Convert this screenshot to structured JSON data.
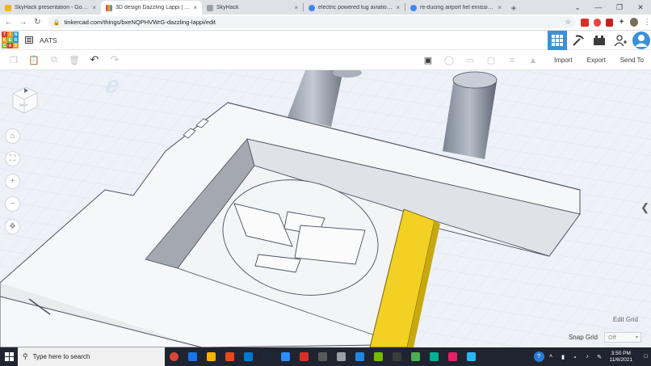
{
  "browser": {
    "tabs": [
      {
        "label": "SkyHack presentation - Google Sl",
        "favicon_color": "#f4b400",
        "active": false
      },
      {
        "label": "3D design Dazzling Lappi | Tinke",
        "favicon_color": "#e64b3c",
        "active": true
      },
      {
        "label": "SkyHack",
        "favicon_color": "#9aa0a6",
        "active": false
      },
      {
        "label": "electric powered tug aviation - G",
        "favicon_color": "#4285f4",
        "active": false
      },
      {
        "label": "re-ducing airport fiel emissions -",
        "favicon_color": "#4285f4",
        "active": false
      }
    ],
    "tab_close_glyph": "×",
    "new_tab_glyph": "+",
    "window_controls": {
      "dropdown": "⌄",
      "minimize": "—",
      "maximize": "❐",
      "close": "✕"
    },
    "url": "tinkercad.com/things/bxeNQPHVWrG-dazzling-lappi/edit"
  },
  "app": {
    "logo_letters": [
      "TIN",
      "KER",
      "CAD"
    ],
    "logo_colors": [
      "#e2372f",
      "#f29a1d",
      "#2b9fd9",
      "#f29a1d",
      "#7bbf44",
      "#2b9fd9",
      "#7bbf44",
      "#e2372f",
      "#f29a1d"
    ],
    "design_name": "AATS",
    "accent": "#3d8fd9"
  },
  "toolbar": {
    "import_label": "Import",
    "export_label": "Export",
    "send_to_label": "Send To"
  },
  "canvas": {
    "viewcube_label": "BACK",
    "edit_grid_label": "Edit Grid",
    "snap_grid_label": "Snap Grid",
    "snap_grid_value": "Off",
    "highlight_color": "#f2d024"
  },
  "taskbar": {
    "search_placeholder": "Type here to search",
    "time": "3:50 PM",
    "date": "11/6/2021",
    "app_colors": [
      "#db4437",
      "#1a73e8",
      "#f4b400",
      "#e64a19",
      "#0078d4",
      "#1b2838",
      "#2d8cff",
      "#d93025",
      "#5a5a5a",
      "#9aa0a6",
      "#1e88e5",
      "#76b900",
      "#3c3c3c",
      "#4caf50",
      "#00b294",
      "#e91e63",
      "#29b6f6"
    ]
  }
}
